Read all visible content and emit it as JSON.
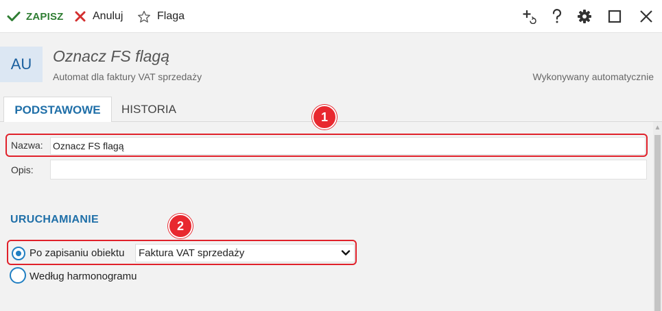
{
  "toolbar": {
    "save_label": "ZAPISZ",
    "cancel_label": "Anuluj",
    "flag_label": "Flaga"
  },
  "header": {
    "avatar_text": "AU",
    "title": "Oznacz FS flagą",
    "subtitle": "Automat dla faktury VAT sprzedaży",
    "right_text": "Wykonywany automatycznie"
  },
  "tabs": [
    {
      "label": "PODSTAWOWE",
      "active": true
    },
    {
      "label": "HISTORIA",
      "active": false
    }
  ],
  "form": {
    "name_label": "Nazwa:",
    "name_value": "Oznacz FS flagą",
    "description_label": "Opis:",
    "description_value": ""
  },
  "trigger": {
    "section_title": "URUCHAMIANIE",
    "option_on_save_label": "Po zapisaniu obiektu",
    "option_on_save_selected": true,
    "object_select_value": "Faktura VAT sprzedaży",
    "option_schedule_label": "Według harmonogramu",
    "option_schedule_selected": false
  },
  "callouts": [
    "1",
    "2"
  ],
  "icons": {
    "save": "check-icon",
    "cancel": "x-icon",
    "flag": "star-outline-icon",
    "add": "add-refresh-icon",
    "help": "question-icon",
    "settings": "gear-icon",
    "maximize": "maximize-icon",
    "close": "close-icon"
  },
  "colors": {
    "accent": "#1f6fa8",
    "save_green": "#2e7d32",
    "cancel_red": "#d32f2f",
    "callout_red": "#e8282f",
    "background": "#f2f2f2"
  }
}
